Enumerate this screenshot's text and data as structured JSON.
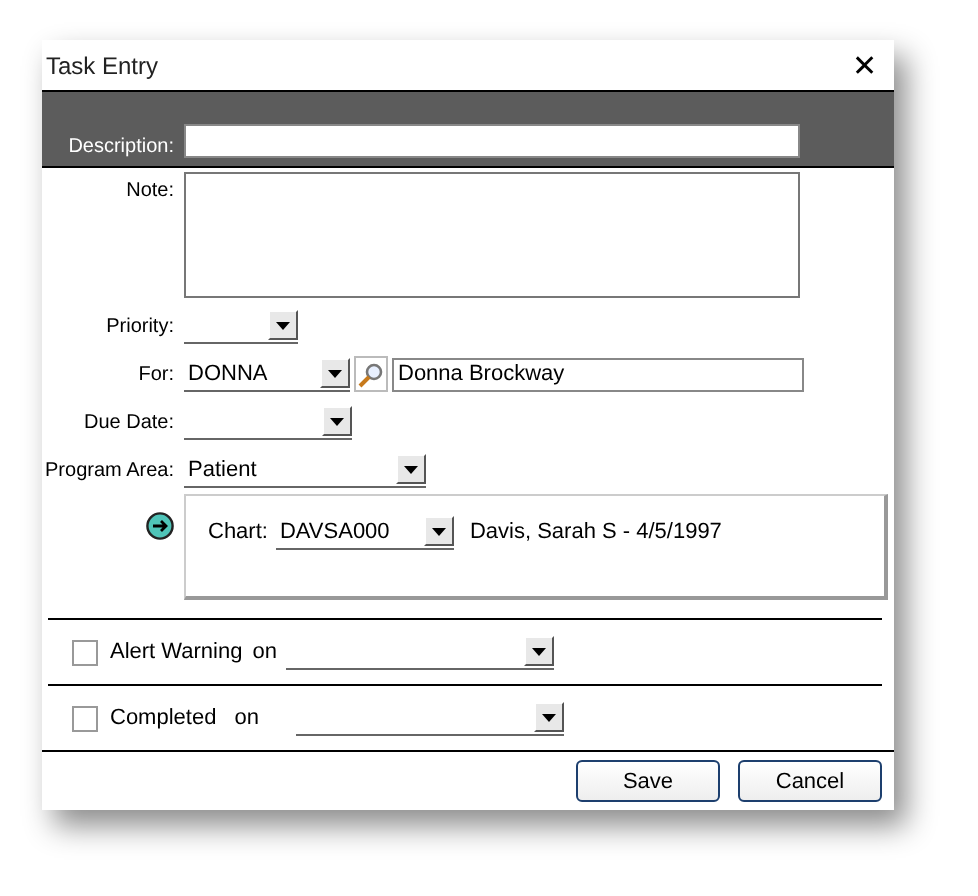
{
  "window": {
    "title": "Task Entry",
    "close": "✕"
  },
  "description": {
    "label": "Description:"
  },
  "note": {
    "label": "Note:"
  },
  "priority": {
    "label": "Priority:"
  },
  "for": {
    "label": "For:",
    "value": "DONNA",
    "name": "Donna Brockway"
  },
  "due_date": {
    "label": "Due Date:"
  },
  "program_area": {
    "label": "Program Area:",
    "value": "Patient"
  },
  "chart": {
    "label": "Chart:",
    "value": "DAVSA000",
    "patient": "Davis, Sarah S - 4/5/1997"
  },
  "options": [
    {
      "label": "Alert Warning",
      "on": "on",
      "checked": false
    },
    {
      "label": "Completed",
      "on": "on",
      "checked": false
    }
  ],
  "buttons": [
    "Save",
    "Cancel"
  ]
}
